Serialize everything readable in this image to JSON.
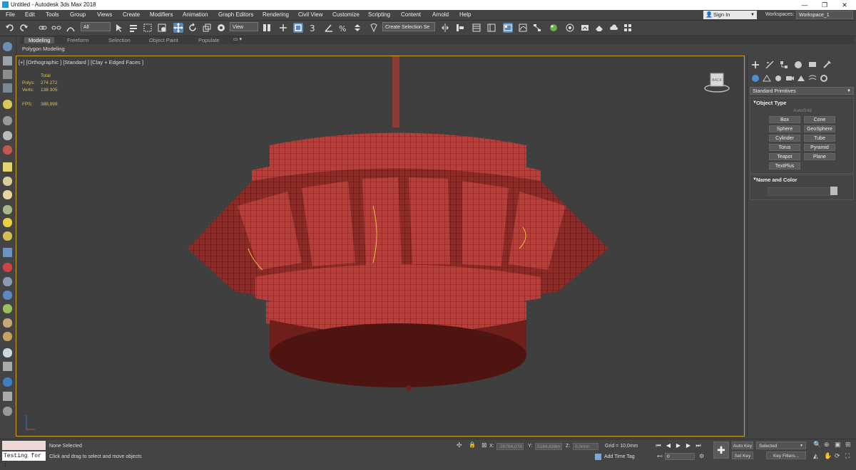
{
  "window": {
    "title": "Untitled - Autodesk 3ds Max 2018",
    "minimize": "—",
    "restore": "❐",
    "close": "✕"
  },
  "menu": {
    "items": [
      "File",
      "Edit",
      "Tools",
      "Group",
      "Views",
      "Create",
      "Modifiers",
      "Animation",
      "Graph Editors",
      "Rendering",
      "Civil View",
      "Customize",
      "Scripting",
      "Content",
      "Arnold",
      "Help"
    ],
    "sign_in": "Sign In",
    "workspaces_label": "Workspaces:",
    "workspace_value": "Workspace_1"
  },
  "toolbar": {
    "selection_filter": "All",
    "reference_coord": "View",
    "create_selection_set": "Create Selection Se"
  },
  "ribbon": {
    "tabs": [
      "Modeling",
      "Freeform",
      "Selection",
      "Object Paint",
      "Populate"
    ],
    "active_tab": "Modeling",
    "sub_label": "Polygon Modeling"
  },
  "viewport": {
    "label": "[+] [Orthographic ] [Standard ] [Clay + Edged Faces ]",
    "stats": {
      "total_label": "Total",
      "polys_label": "Polys:",
      "polys_value": "274 272",
      "verts_label": "Verts:",
      "verts_value": "138 305",
      "fps_label": "FPS:",
      "fps_value": "388,999"
    },
    "viewcube_label": "BACK"
  },
  "command_panel": {
    "category": "Standard Primitives",
    "object_type_title": "Object Type",
    "autogrid": "AutoGrid",
    "buttons": [
      "Box",
      "Cone",
      "Sphere",
      "GeoSphere",
      "Cylinder",
      "Tube",
      "Torus",
      "Pyramid",
      "Teapot",
      "Plane",
      "TextPlus"
    ],
    "name_color_title": "Name and Color"
  },
  "statusbar": {
    "script_listener": "Testing for :",
    "selection_status": "None Selected",
    "prompt": "Click and drag to select and move objects",
    "x_label": "X:",
    "x_value": "-20784,078",
    "y_label": "Y:",
    "y_value": "5184,838m",
    "z_label": "Z:",
    "z_value": "0,0mm",
    "grid": "Grid = 10,0mm",
    "add_time_tag": "Add Time Tag",
    "frame_value": "0",
    "auto_key": "Auto Key",
    "set_key": "Set Key",
    "selected_dropdown": "Selected",
    "key_filters": "Key Filters..."
  },
  "colors": {
    "accent_blue": "#1f9ad6",
    "viewport_border": "#c9a227",
    "model_red": "#b5403b"
  }
}
